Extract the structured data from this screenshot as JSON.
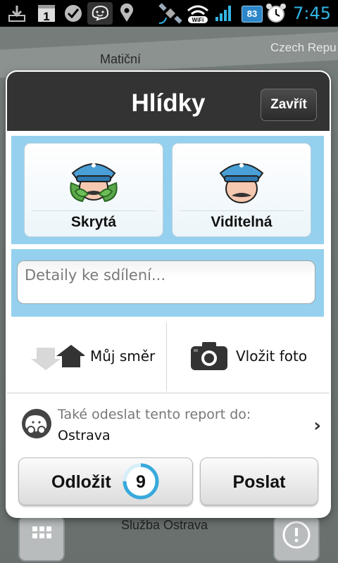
{
  "status_bar": {
    "time": "7:45",
    "battery": "83",
    "time_color": "#33b5e5",
    "icons": [
      "download-icon",
      "calendar-icon",
      "app-icon",
      "waze-icon",
      "location-icon",
      "satellite-icon",
      "wifi-icon",
      "signal-icon",
      "battery-icon",
      "alarm-icon"
    ],
    "calendar_day": "1",
    "wifi_label": "WiFi"
  },
  "map": {
    "labels": [
      "Matiční",
      "Czech Repu",
      "Služba Ostrava"
    ]
  },
  "dialog": {
    "title": "Hlídky",
    "close_label": "Zavřít",
    "types": [
      {
        "label": "Skrytá",
        "icon": "hidden-police-icon"
      },
      {
        "label": "Viditelná",
        "icon": "visible-police-icon"
      }
    ],
    "details_placeholder": "Detaily ke sdílení...",
    "direction_label": "Můj směr",
    "photo_label": "Vložit foto",
    "share_title": "Také odeslat tento report do:",
    "share_target": "Ostrava",
    "later_label": "Odložit",
    "countdown": "9",
    "countdown_progress": 0.75,
    "send_label": "Poslat",
    "accent_color": "#95d1ee",
    "header_color": "#333333"
  }
}
